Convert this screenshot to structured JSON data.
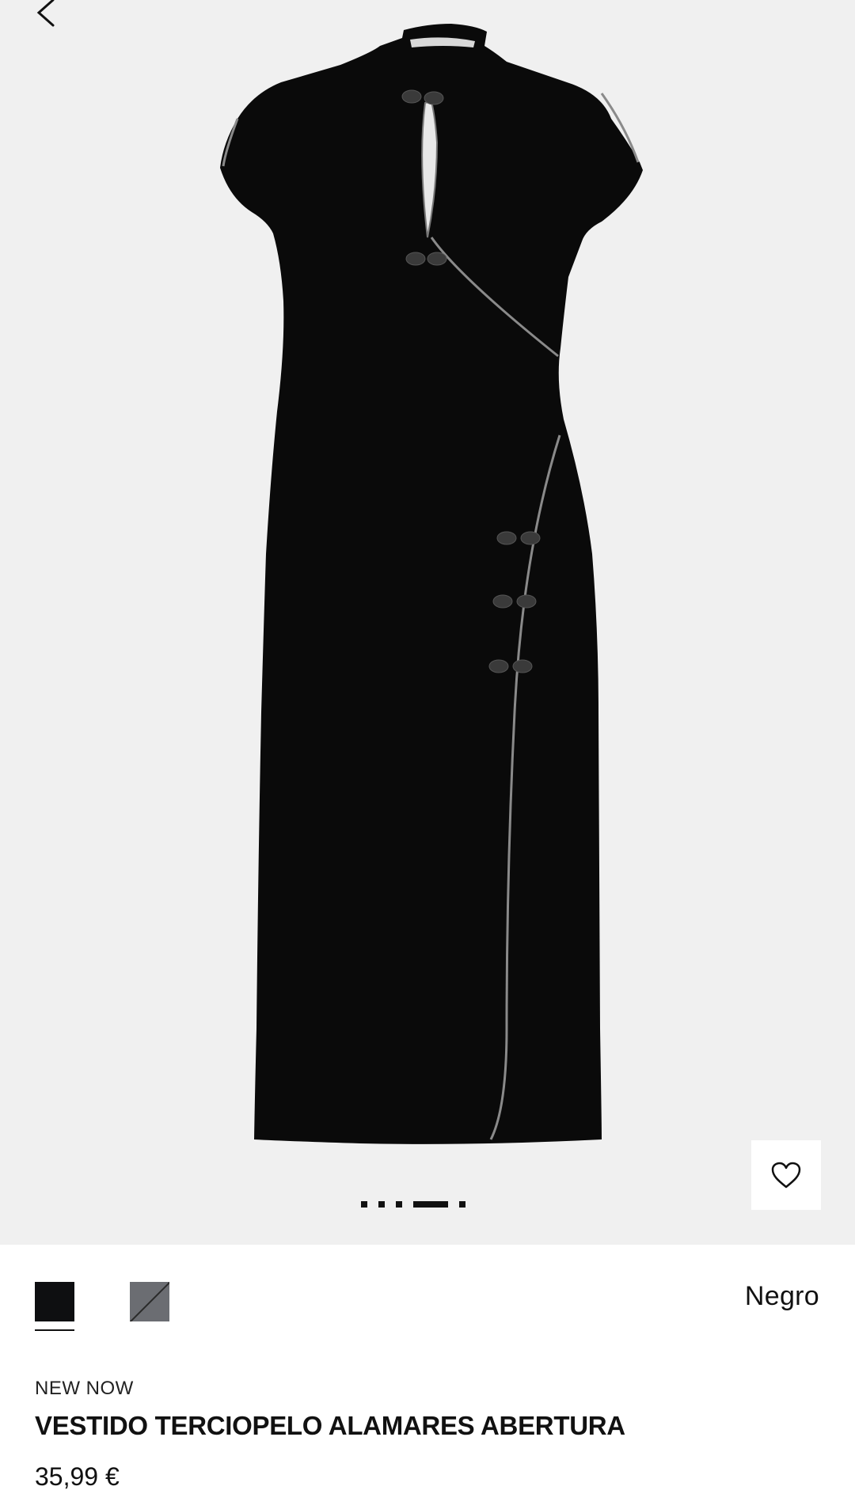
{
  "product": {
    "tag": "NEW NOW",
    "title": "VESTIDO TERCIOPELO ALAMARES ABERTURA",
    "price": "35,99 €",
    "selected_color": "Negro",
    "colors": [
      {
        "name": "Negro",
        "hex": "#0e0f11",
        "selected": true
      },
      {
        "name": "Gris",
        "hex": "#6b6d72",
        "selected": false
      }
    ]
  },
  "gallery": {
    "image_count": 5,
    "active_index": 3
  },
  "icons": {
    "back": "chevron-left-icon",
    "favorite": "heart-outline-icon"
  },
  "colors": {
    "gallery_bg": "#f0f0f0",
    "text": "#111111",
    "dress": "#0a0a0a"
  }
}
